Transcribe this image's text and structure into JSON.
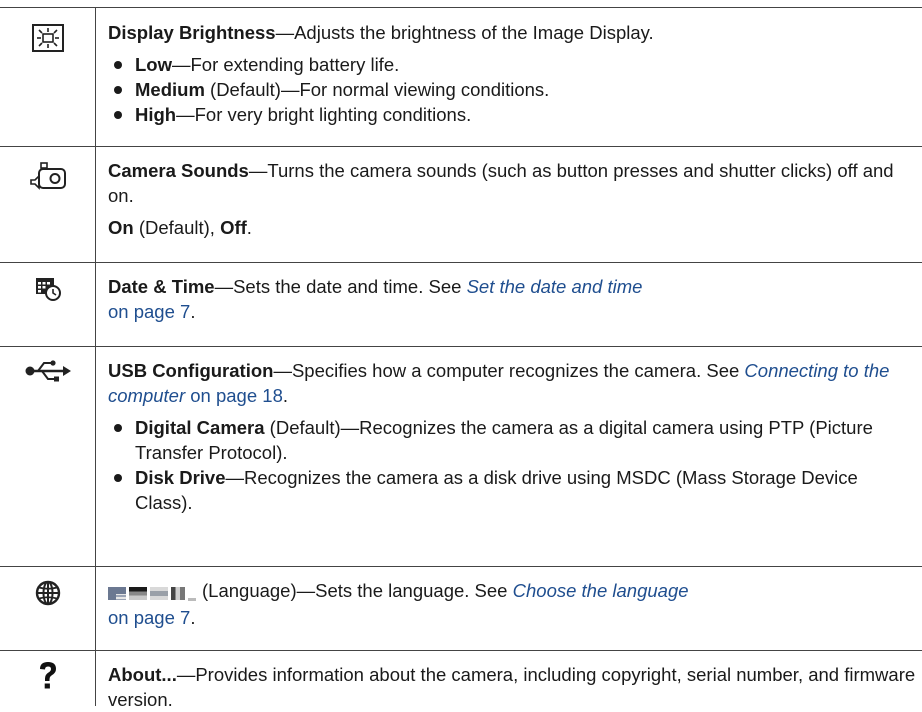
{
  "rows": [
    {
      "icon": "display-brightness-icon",
      "title": "Display Brightness",
      "desc": "—Adjusts the brightness of the Image Display.",
      "items": [
        {
          "bold": "Low",
          "text": "—For extending battery life."
        },
        {
          "bold": "Medium",
          "text": " (Default)—For normal viewing conditions."
        },
        {
          "bold": "High",
          "text": "—For very bright lighting conditions."
        }
      ]
    },
    {
      "icon": "camera-sounds-icon",
      "title": "Camera Sounds",
      "desc": "—Turns the camera sounds (such as button presses and shutter clicks) off and on.",
      "note_on": "On",
      "note_default": " (Default), ",
      "note_off": "Off",
      "note_end": "."
    },
    {
      "icon": "calendar-clock-icon",
      "title": "Date & Time",
      "desc": "—Sets the date and time. See ",
      "link": "Set the date and time",
      "link_page": "on page 7",
      "end": "."
    },
    {
      "icon": "usb-icon",
      "title": "USB Configuration",
      "desc": "—Specifies how a computer recognizes the camera. See ",
      "link": "Connecting to the computer",
      "link_page": " on page 18",
      "end": ".",
      "items": [
        {
          "bold": "Digital Camera",
          "text": "  (Default)—Recognizes the camera as a digital camera using PTP (Picture Transfer Protocol)."
        },
        {
          "bold": "Disk Drive",
          "text": "—Recognizes the camera as a disk drive using MSDC (Mass Storage Device Class)."
        }
      ]
    },
    {
      "icon": "globe-icon",
      "flags_icon": "language-flags-icon",
      "desc": "(Language)—Sets the language. See ",
      "link": "Choose the language",
      "link_page": "on page 7",
      "end": "."
    },
    {
      "icon": "question-mark-icon",
      "title": "About...",
      "desc": "—Provides information about the camera, including copyright, serial number, and firmware version."
    }
  ]
}
